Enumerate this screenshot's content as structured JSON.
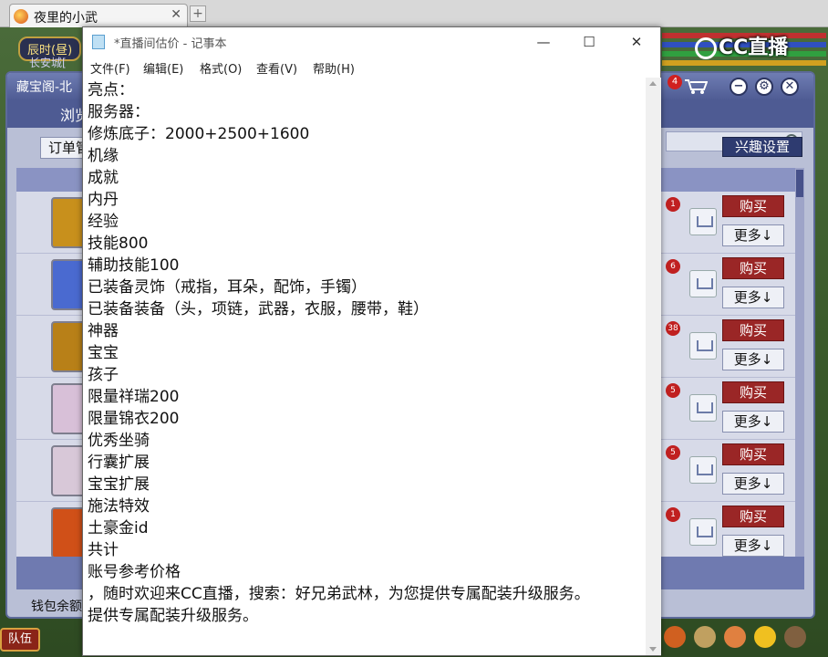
{
  "browser": {
    "tab_title": "夜里的小武",
    "tab_close": "✕",
    "new_tab": "+"
  },
  "game": {
    "time_label": "辰时(昼)",
    "location": "长安城[",
    "cc_logo": "CC直播",
    "team_button": "队伍",
    "wallet_label": "钱包余额"
  },
  "shop": {
    "title": "藏宝阁-北",
    "browse_tab": "浏览",
    "cart_count": "4",
    "order_button": "订单管",
    "interest_button": "兴趣设置",
    "rows": [
      {
        "badge": "1",
        "buy": "购买",
        "more": "更多↓",
        "avatar_color": "#c8901c"
      },
      {
        "badge": "6",
        "buy": "购买",
        "more": "更多↓",
        "avatar_color": "#4a6ad0"
      },
      {
        "badge": "38",
        "buy": "购买",
        "more": "更多↓",
        "avatar_color": "#b88018"
      },
      {
        "badge": "5",
        "buy": "购买",
        "more": "更多↓",
        "avatar_color": "#d8c0d8"
      },
      {
        "badge": "5",
        "buy": "购买",
        "more": "更多↓",
        "avatar_color": "#d8c8d8"
      },
      {
        "badge": "1",
        "buy": "购买",
        "more": "更多↓",
        "avatar_color": "#d05018"
      }
    ]
  },
  "notepad": {
    "title": "*直播间估价 - 记事本",
    "controls": {
      "minimize": "—",
      "maximize": "☐",
      "close": "✕"
    },
    "menu": [
      "文件(F)",
      "编辑(E)",
      "格式(O)",
      "查看(V)",
      "帮助(H)"
    ],
    "lines": [
      "亮点：",
      "服务器：",
      "修炼底子：2000+2500+1600",
      "机缘",
      "成就",
      "内丹",
      "经验",
      "技能800",
      "辅助技能100",
      "已装备灵饰（戒指，耳朵，配饰，手镯）",
      "已装备装备（头，项链，武器，衣服，腰带，鞋）",
      "神器",
      "宝宝",
      "孩子",
      "限量祥瑞200",
      "限量锦衣200",
      "优秀坐骑",
      "行囊扩展",
      "宝宝扩展",
      "施法特效",
      "土豪金id",
      "共计",
      "账号参考价格",
      "，随时欢迎来CC直播，搜索：好兄弟武林，为您提供专属配装升级服务。",
      "提供专属配装升级服务。"
    ]
  }
}
